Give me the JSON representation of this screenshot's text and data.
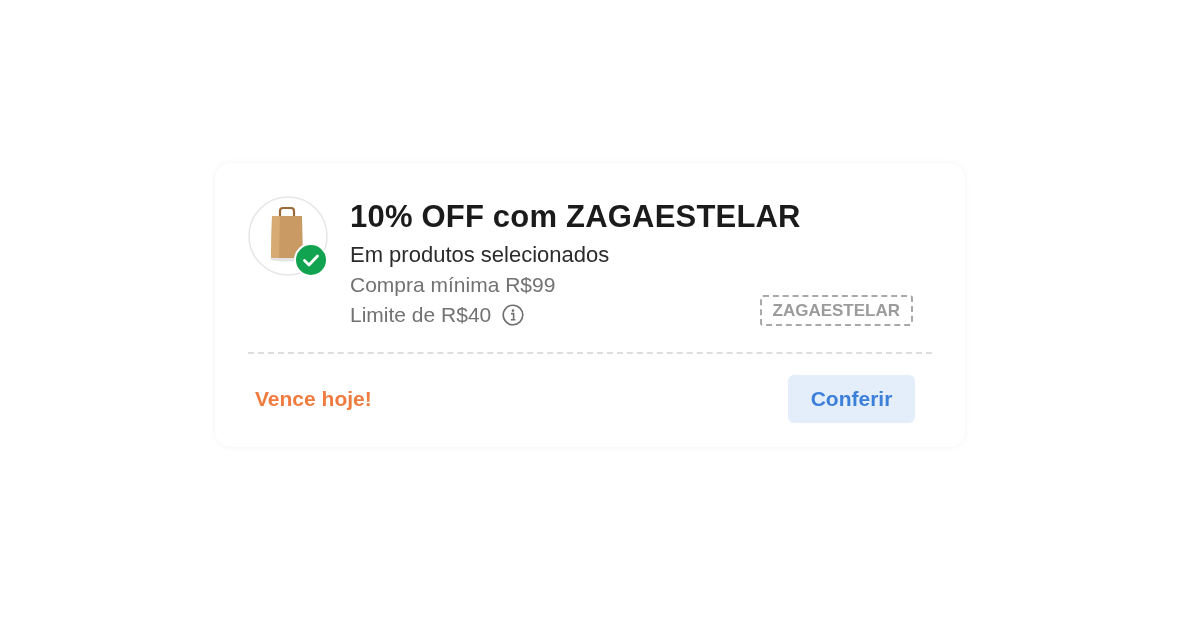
{
  "coupon": {
    "title": "10% OFF com ZAGAESTELAR",
    "subtitle": "Em produtos selecionados",
    "details": [
      {
        "text": "Compra mínima R$99",
        "info": false
      },
      {
        "text": "Limite de R$40",
        "info": true
      }
    ],
    "code": "ZAGAESTELAR",
    "expiry": "Vence hoje!",
    "action": "Conferir"
  }
}
